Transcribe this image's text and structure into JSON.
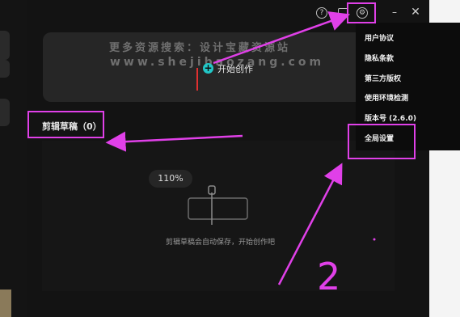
{
  "watermark": {
    "line1": "更多资源搜索：设计宝藏资源站",
    "line2": "www.shejibaozang.com"
  },
  "topbar": {
    "help_icon": "help-circle-icon",
    "feedback_icon": "monitor-icon",
    "settings_icon": "gear-icon",
    "minimize_icon": "minimize-icon",
    "close_icon": "close-icon"
  },
  "create": {
    "label": "开始创作",
    "icon": "plus-icon"
  },
  "drafts": {
    "title": "剪辑草稿（0）",
    "zoom": "110%",
    "empty_text": "剪辑草稿会自动保存，开始创作吧"
  },
  "settings_menu": {
    "items": [
      {
        "label": "用户协议"
      },
      {
        "label": "隐私条款"
      },
      {
        "label": "第三方版权"
      },
      {
        "label": "使用环境检测"
      },
      {
        "label": "版本号 (2.6.0)"
      },
      {
        "label": "全局设置"
      }
    ]
  },
  "annotation": {
    "number": "2",
    "color": "#e040e8"
  },
  "colors": {
    "accent": "#22c7c7",
    "annotation": "#e040e8",
    "background": "#131313"
  }
}
